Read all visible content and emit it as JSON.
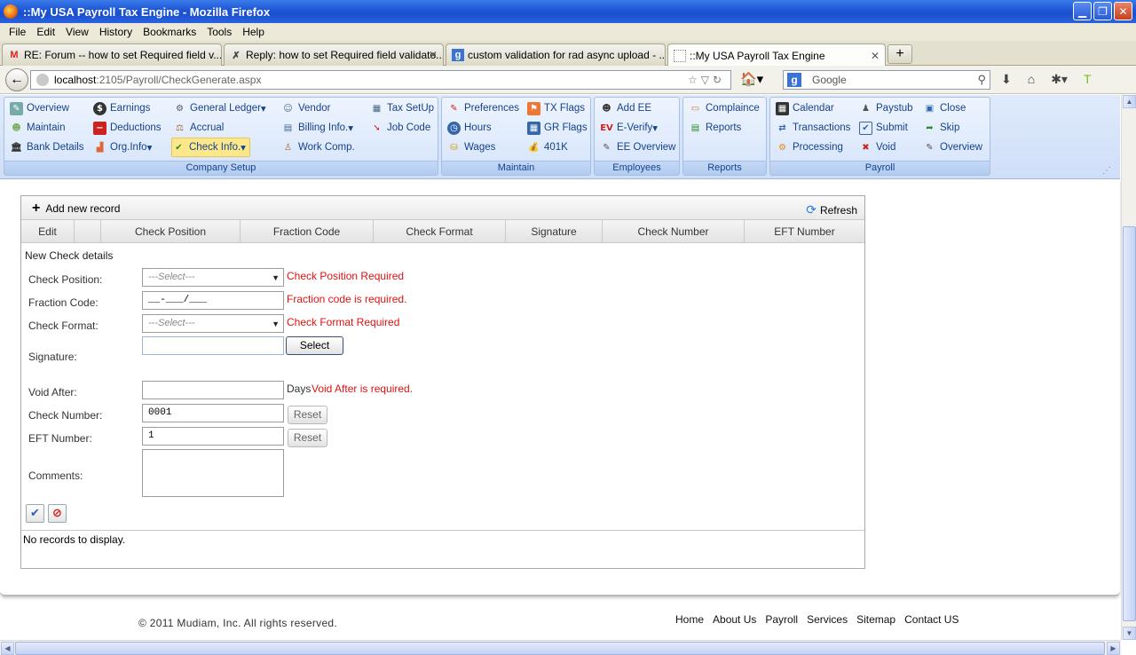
{
  "window": {
    "title": "::My USA Payroll Tax Engine - Mozilla Firefox"
  },
  "menu": [
    "File",
    "Edit",
    "View",
    "History",
    "Bookmarks",
    "Tools",
    "Help"
  ],
  "tabs": [
    {
      "label": "RE: Forum -- how to set Required field v...",
      "icon": "gmail-icon"
    },
    {
      "label": "Reply: how to set Required field validato...",
      "icon": "forum-icon"
    },
    {
      "label": "custom validation for rad async upload - ...",
      "icon": "google-icon"
    },
    {
      "label": "::My USA Payroll Tax Engine",
      "icon": "blank-page-icon",
      "active": true
    }
  ],
  "url": {
    "host": "localhost",
    "path": ":2105/Payroll/CheckGenerate.aspx"
  },
  "search": {
    "placeholder": "Google"
  },
  "ribbon": {
    "groups": [
      {
        "title": "Company Setup"
      },
      {
        "title": "Maintain"
      },
      {
        "title": "Employees"
      },
      {
        "title": "Reports"
      },
      {
        "title": "Payroll"
      }
    ],
    "items": {
      "overview": "Overview",
      "maintain": "Maintain",
      "bank_details": "Bank Details",
      "earnings": "Earnings",
      "deductions": "Deductions",
      "org_info": "Org.Info",
      "general_ledger": "General Ledger",
      "accrual": "Accrual",
      "check_info": "Check Info.",
      "vendor": "Vendor",
      "billing_info": "Billing Info.",
      "work_comp": "Work Comp.",
      "tax_setup": "Tax SetUp",
      "job_code": "Job Code",
      "preferences": "Preferences",
      "hours": "Hours",
      "wages": "Wages",
      "tx_flags": "TX Flags",
      "gr_flags": "GR Flags",
      "k401": "401K",
      "add_ee": "Add EE",
      "e_verify": "E-Verify",
      "ee_overview": "EE Overview",
      "complaince": "Complaince",
      "reports": "Reports",
      "calendar": "Calendar",
      "transactions": "Transactions",
      "processing": "Processing",
      "paystub": "Paystub",
      "submit": "Submit",
      "void": "Void",
      "close": "Close",
      "skip": "Skip",
      "payroll_overview": "Overview"
    }
  },
  "grid": {
    "add_label": "Add new record",
    "refresh_label": "Refresh",
    "columns": [
      "Edit",
      "",
      "Check Position",
      "Fraction Code",
      "Check Format",
      "Signature",
      "Check Number",
      "EFT Number"
    ],
    "no_records": "No records to display."
  },
  "form": {
    "title": "New Check details",
    "check_position": {
      "label": "Check Position:",
      "value": "---Select---",
      "error": "Check Position Required"
    },
    "fraction_code": {
      "label": "Fraction Code:",
      "value": "__-___/___",
      "error": "Fraction code is required."
    },
    "check_format": {
      "label": "Check Format:",
      "value": "---Select---",
      "error": "Check Format Required"
    },
    "signature": {
      "label": "Signature:",
      "value": "",
      "button": "Select"
    },
    "void_after": {
      "label": "Void After:",
      "value": "",
      "unit": "Days",
      "error": "Void After is required."
    },
    "check_number": {
      "label": "Check Number:",
      "value": "0001",
      "button": "Reset"
    },
    "eft_number": {
      "label": "EFT Number:",
      "value": "1",
      "button": "Reset"
    },
    "comments": {
      "label": "Comments:",
      "value": ""
    }
  },
  "footer": {
    "copyright": "© 2011 Mudiam, Inc. All rights reserved.",
    "links": [
      "Home",
      "About Us",
      "Payroll",
      "Services",
      "Sitemap",
      "Contact US"
    ]
  },
  "colors": {
    "error": "#dd1111",
    "ribbon_text": "#15428b",
    "selected_item": "#fce88a"
  }
}
